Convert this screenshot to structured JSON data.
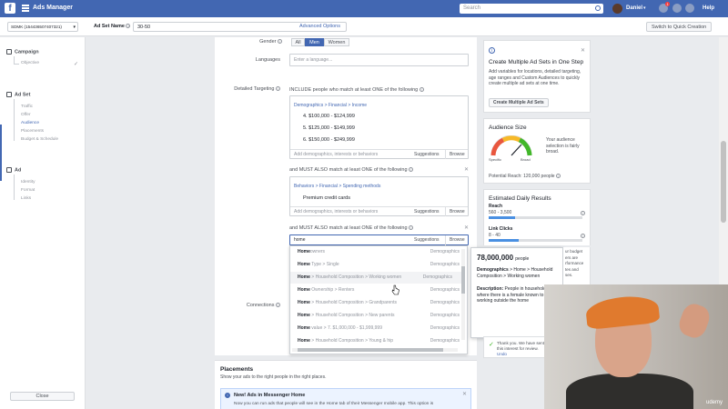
{
  "topbar": {
    "logo": "f",
    "title": "Ads Manager",
    "search_placeholder": "Search",
    "user_name": "Daniel",
    "notifications": "1",
    "help": "Help"
  },
  "toolbar": {
    "account": "SDMK (154436507407321)",
    "adset_name_label": "Ad Set Name",
    "adset_name_value": "30-50",
    "advanced_options": "Advanced Options",
    "switch_button": "Switch to Quick Creation"
  },
  "sidebar": {
    "campaign": "Campaign",
    "campaign_items": [
      "Objective"
    ],
    "adset": "Ad Set",
    "adset_items": [
      "Traffic",
      "Offer",
      "Audience",
      "Placements",
      "Budget & Schedule"
    ],
    "ad": "Ad",
    "ad_items": [
      "Identity",
      "Format",
      "Links"
    ],
    "close": "Close"
  },
  "form": {
    "gender_label": "Gender",
    "gender_options": [
      "All",
      "Men",
      "Women"
    ],
    "languages_label": "Languages",
    "languages_placeholder": "Enter a language...",
    "detailed_targeting_label": "Detailed Targeting",
    "include_text": "INCLUDE people who match at least ONE of the following",
    "group1_crumb": "Demographics > Financial > Income",
    "group1_items": [
      "4. $100,000 - $124,999",
      "5. $125,000 - $149,999",
      "6. $150,000 - $249,999"
    ],
    "add_placeholder": "Add demographics, interests or behaviors",
    "suggestions": "Suggestions",
    "browse": "Browse",
    "must_also_text": "and MUST ALSO match at least ONE of the following",
    "group2_crumb": "Behaviors > Financial > Spending methods",
    "group2_items": [
      "Premium credit cards"
    ],
    "search_value": "home",
    "connections_label": "Connections"
  },
  "dropdown": {
    "rows": [
      {
        "bold": "Home",
        "rest": "owners",
        "cat": "Demographics"
      },
      {
        "bold": "Home",
        "rest": " Type > Single",
        "cat": "Demographics"
      },
      {
        "bold": "Home",
        "rest": " > Household Composition > Working women",
        "cat": "Demographics"
      },
      {
        "bold": "Home",
        "rest": " Ownership > Renters",
        "cat": "Demographics"
      },
      {
        "bold": "Home",
        "rest": " > Household Composition > Grandparents",
        "cat": "Demographics"
      },
      {
        "bold": "Home",
        "rest": " > Household Composition > New parents",
        "cat": "Demographics"
      },
      {
        "bold": "Home",
        "rest": " value > 7. $1,000,000 - $1,999,999",
        "cat": "Demographics"
      },
      {
        "bold": "Home",
        "rest": " > Household Composition > Young & hip",
        "cat": "Demographics"
      }
    ]
  },
  "tooltip": {
    "count": "78,000,000",
    "unit": "people",
    "path_label": "Demographics",
    "path_rest": " > Home > Household Composition > Working women",
    "desc_label": "Description:",
    "desc_rest": " People in household where there is a female known to be working outside the home"
  },
  "right": {
    "card1_title": "Create Multiple Ad Sets in One Step",
    "card1_text": "Add variables for locations, detailed targeting, age ranges and Custom Audiences to quickly create multiple ad sets at one time.",
    "card1_button": "Create Multiple Ad Sets",
    "card2_title": "Audience Size",
    "gauge_left": "Specific",
    "gauge_right": "Broad",
    "audience_text": "Your audience selection is fairly broad.",
    "potential_reach": "Potential Reach: 120,000 people",
    "card3_title": "Estimated Daily Results",
    "reach_label": "Reach",
    "reach_value": "560 - 3,500",
    "reach_fill": 0.28,
    "clicks_label": "Link Clicks",
    "clicks_value": "8 - 40",
    "clicks_fill": 0.32,
    "budget_fragments": [
      "ur budget",
      "ers are",
      "rformance",
      "tes and",
      "ses."
    ],
    "thank_you": "Thank you. We have sent this interest for review.",
    "undo": "Undo"
  },
  "placements": {
    "title": "Placements",
    "subtitle": "Show your ads to the right people in the right places.",
    "messenger_title": "New! Ads in Messenger Home",
    "messenger_text": "Now you can run ads that people will see in the Home tab of their Messenger mobile app. This option is"
  },
  "webcam": {
    "watermark": "udemy"
  }
}
